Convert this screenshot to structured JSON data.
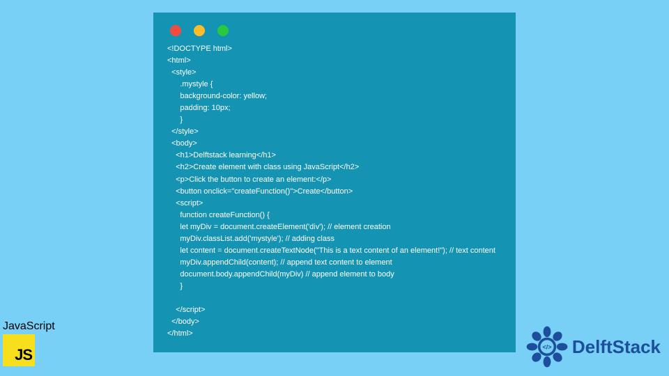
{
  "window": {
    "dots": [
      "red",
      "yellow",
      "green"
    ]
  },
  "code_lines": [
    "<!DOCTYPE html>",
    "<html>",
    "  <style>",
    "      .mystyle {",
    "      background-color: yellow;",
    "      padding: 10px;",
    "      }",
    "  </style>",
    "  <body>",
    "    <h1>Delftstack learning</h1>",
    "    <h2>Create element with class using JavaScript</h2>",
    "    <p>Click the button to create an element:</p>",
    "    <button onclick=\"createFunction()\">Create</button>",
    "    <script>",
    "      function createFunction() {",
    "      let myDiv = document.createElement('div'); // element creation",
    "      myDiv.classList.add('mystyle'); // adding class",
    "      let content = document.createTextNode(\"This is a text content of an element!\"); // text content",
    "      myDiv.appendChild(content); // append text content to element",
    "      document.body.appendChild(myDiv) // append element to body",
    "      }",
    "",
    "    </script>",
    "  </body>",
    "</html>"
  ],
  "badges": {
    "js_label": "JavaScript",
    "js_logo_text": "JS",
    "delft_text": "DelftStack",
    "delft_code_glyph": "</>"
  }
}
